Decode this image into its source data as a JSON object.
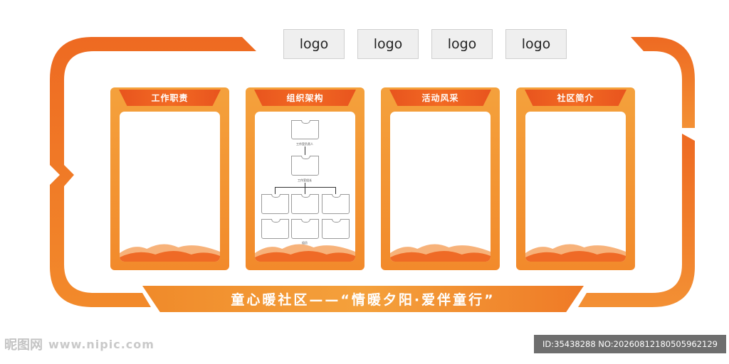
{
  "logos": [
    "logo",
    "logo",
    "logo",
    "logo"
  ],
  "panels": [
    {
      "title": "工作职责"
    },
    {
      "title": "组织架构"
    },
    {
      "title": "活动风采"
    },
    {
      "title": "社区简介"
    }
  ],
  "org_chart": {
    "leader_label": "工作室负责人",
    "group_leader_label": "工作室组长",
    "members_label": "组员"
  },
  "banner": {
    "text": "童心暖社区——“情暖夕阳·爱伴童行”"
  },
  "watermark": {
    "brand": "昵图网",
    "url": "www.nipic.com",
    "id_text": "ID:35438288 NO:20260812180505962129"
  },
  "colors": {
    "accent_orange": "#f28a2b",
    "accent_red_orange": "#e8541e",
    "light_orange": "#f4a13c"
  }
}
